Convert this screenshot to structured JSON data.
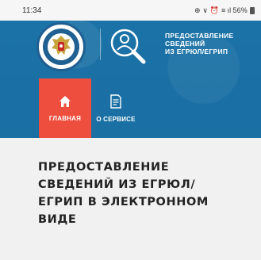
{
  "status_bar": {
    "time": "11:34",
    "indicators": "⊕ ∨ ⏰ ≡",
    "signal": "ıl",
    "battery": "56%"
  },
  "header": {
    "logo_icon": "fns-emblem",
    "service_icon": "person-magnifier-icon",
    "service_title_lines": [
      "ПРЕДОСТАВЛЕНИЕ",
      "СВЕДЕНИЙ",
      "ИЗ ЕГРЮЛ/ЕГРИП"
    ]
  },
  "nav": {
    "items": [
      {
        "label": "ГЛАВНАЯ",
        "icon": "home-icon",
        "active": true
      },
      {
        "label": "О СЕРВИСЕ",
        "icon": "document-icon",
        "active": false
      }
    ],
    "active_color": "#ee4e3d"
  },
  "main": {
    "headline": "ПРЕДОСТАВЛЕНИЕ СВЕДЕНИЙ ИЗ ЕГРЮЛ/ ЕГРИП В ЭЛЕКТРОННОМ ВИДЕ"
  },
  "colors": {
    "header_bg": "#1b72a6",
    "content_bg": "#f1f1f1",
    "headline_text": "#222222"
  }
}
